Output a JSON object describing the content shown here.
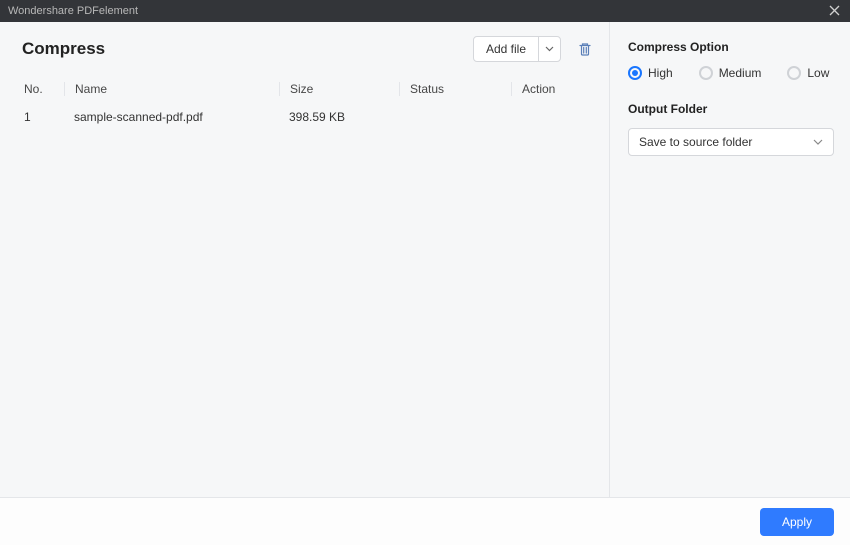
{
  "titlebar": {
    "app_name": "Wondershare PDFelement"
  },
  "main": {
    "title": "Compress",
    "add_file_label": "Add file",
    "columns": {
      "no": "No.",
      "name": "Name",
      "size": "Size",
      "status": "Status",
      "action": "Action"
    },
    "rows": [
      {
        "no": "1",
        "name": "sample-scanned-pdf.pdf",
        "size": "398.59 KB",
        "status": "",
        "action": ""
      }
    ]
  },
  "options": {
    "heading": "Compress Option",
    "levels": {
      "high": "High",
      "medium": "Medium",
      "low": "Low",
      "selected": "high"
    },
    "output_heading": "Output Folder",
    "output_value": "Save to source folder"
  },
  "footer": {
    "apply_label": "Apply"
  }
}
